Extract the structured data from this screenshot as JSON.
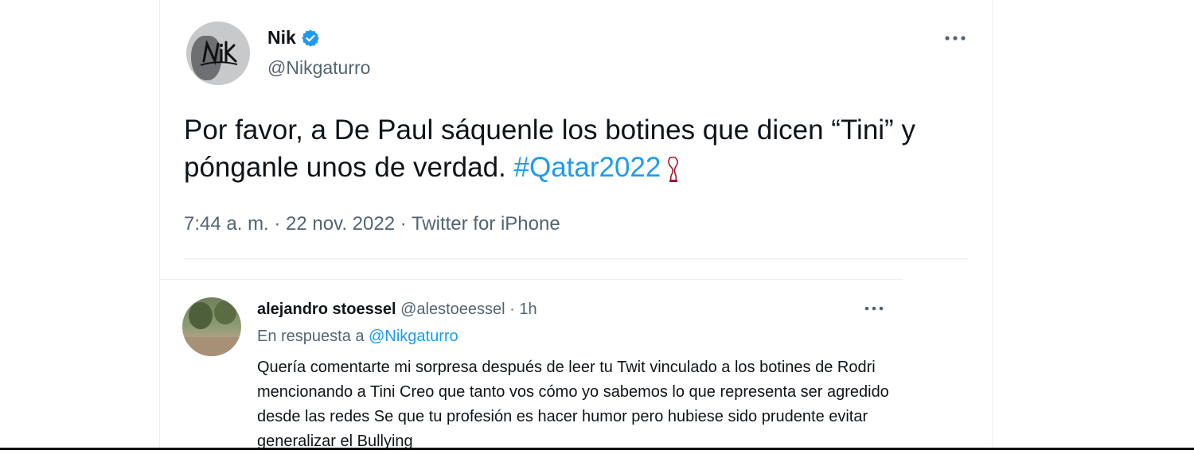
{
  "tweet": {
    "author_name": "Nik",
    "author_handle": "@Nikgaturro",
    "text_part1": "Por favor, a De Paul sáquenle los botines que dicen “Tini” y pónganle unos de verdad. ",
    "hashtag": "#Qatar2022",
    "meta": "7:44 a. m. · 22 nov. 2022 · Twitter for iPhone",
    "verified_color": "#1d9bf0"
  },
  "reply": {
    "author_name": "alejandro stoessel",
    "author_handle": "@alestoeessel",
    "separator": " · ",
    "time": "1h",
    "replying_to_prefix": "En respuesta a ",
    "replying_to_handle": "@Nikgaturro",
    "text": "Quería comentarte mi sorpresa después de leer tu Twit vinculado a los botines de Rodri mencionando a Tini Creo que tanto vos cómo yo sabemos lo que representa ser agredido desde las redes Se que tu profesión es hacer humor pero hubiese sido prudente evitar generalizar el Bullying"
  },
  "colors": {
    "text": "#0f1419",
    "secondary": "#536471",
    "link": "#1d9bf0"
  },
  "icons": {
    "verified": "verified-badge-icon",
    "more": "more-horizontal-icon",
    "trophy": "world-cup-trophy-icon"
  }
}
